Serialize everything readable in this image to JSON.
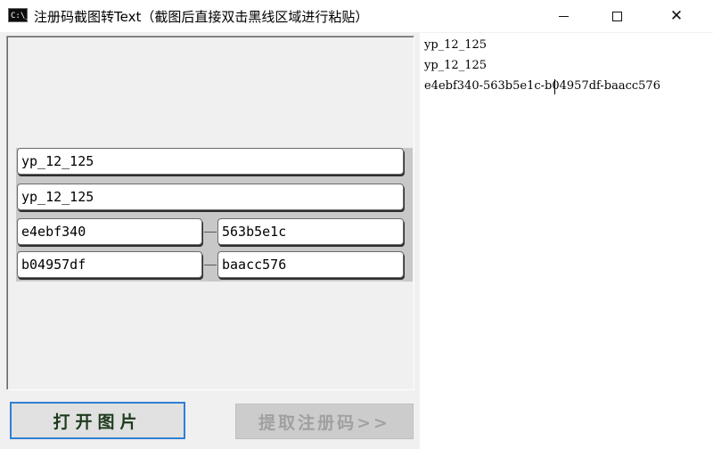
{
  "window": {
    "icon_text": "C:\\_",
    "title": "注册码截图转Text（截图后直接双击黑线区域进行粘贴）",
    "min_icon": "minimize-icon",
    "max_icon": "maximize-icon",
    "close_icon": "close-icon",
    "close_glyph": "✕"
  },
  "fields": {
    "line1": "yp_12_125",
    "line2": "yp_12_125",
    "code1": "e4ebf340",
    "code2": "563b5e1c",
    "code3": "b04957df",
    "code4": "baacc576"
  },
  "buttons": {
    "open": "打开图片",
    "extract": "提取注册码>>"
  },
  "output": {
    "lines": [
      "yp_12_125",
      "yp_12_125",
      "e4ebf340-563b5e1c-b04957df-baacc576"
    ]
  }
}
